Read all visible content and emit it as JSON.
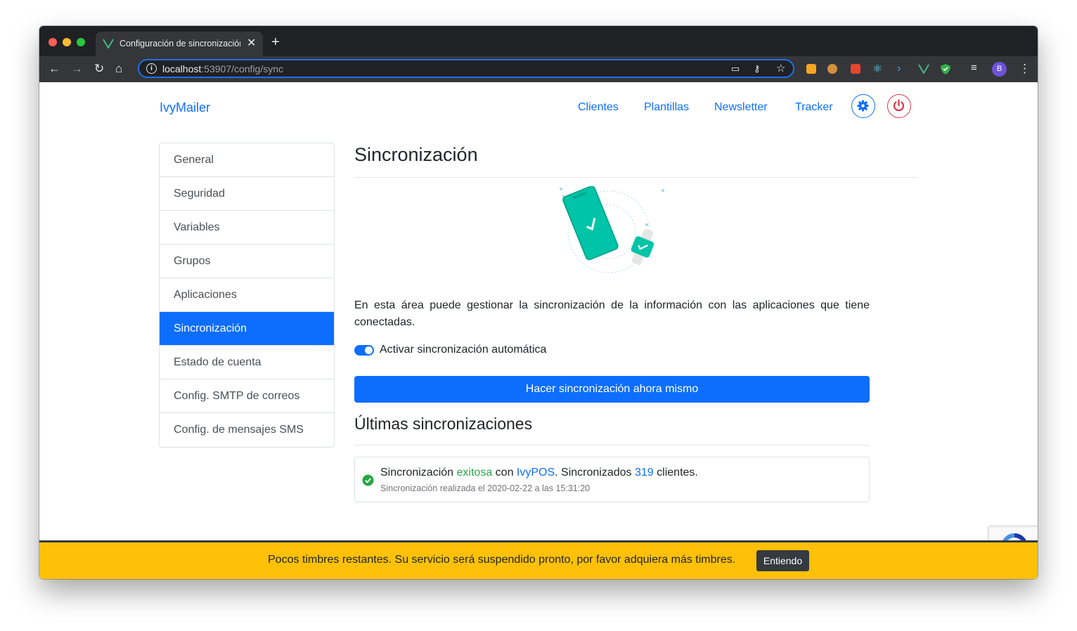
{
  "browser": {
    "tab_title": "Configuración de sincronización",
    "url_host": "localhost",
    "url_rest": ":53907/config/sync",
    "avatar_initial": "B"
  },
  "navbar": {
    "brand": "IvyMailer",
    "links": [
      "Clientes",
      "Plantillas",
      "Newsletter",
      "Tracker"
    ]
  },
  "sidebar": {
    "items": [
      {
        "label": "General",
        "active": false
      },
      {
        "label": "Seguridad",
        "active": false
      },
      {
        "label": "Variables",
        "active": false
      },
      {
        "label": "Grupos",
        "active": false
      },
      {
        "label": "Aplicaciones",
        "active": false
      },
      {
        "label": "Sincronización",
        "active": true
      },
      {
        "label": "Estado de cuenta",
        "active": false
      },
      {
        "label": "Config. SMTP de correos",
        "active": false
      },
      {
        "label": "Config. de mensajes SMS",
        "active": false
      }
    ]
  },
  "main": {
    "title": "Sincronización",
    "description": "En esta área puede gestionar la sincronización de la información con las aplicaciones que tiene conectadas.",
    "toggle_label": "Activar sincronización automática",
    "toggle_on": true,
    "sync_button": "Hacer sincronización ahora mismo",
    "history_title": "Últimas sincronizaciones",
    "entries": [
      {
        "prefix": "Sincronización",
        "status": "exitosa",
        "with": "con",
        "app": "IvyPOS",
        "synced": ". Sincronizados",
        "count": "319",
        "suffix": "clientes.",
        "detail": "Sincronización realizada el 2020-02-22 a las 15:31:20"
      }
    ]
  },
  "banner": {
    "message": "Pocos timbres restantes. Su servicio será suspendido pronto, por favor adquiera más timbres.",
    "button": "Entiendo"
  },
  "colors": {
    "primary": "#0d6efd",
    "success": "#28a745",
    "danger": "#dc3545",
    "warning": "#fec107",
    "illustration": "#00c4a7"
  }
}
